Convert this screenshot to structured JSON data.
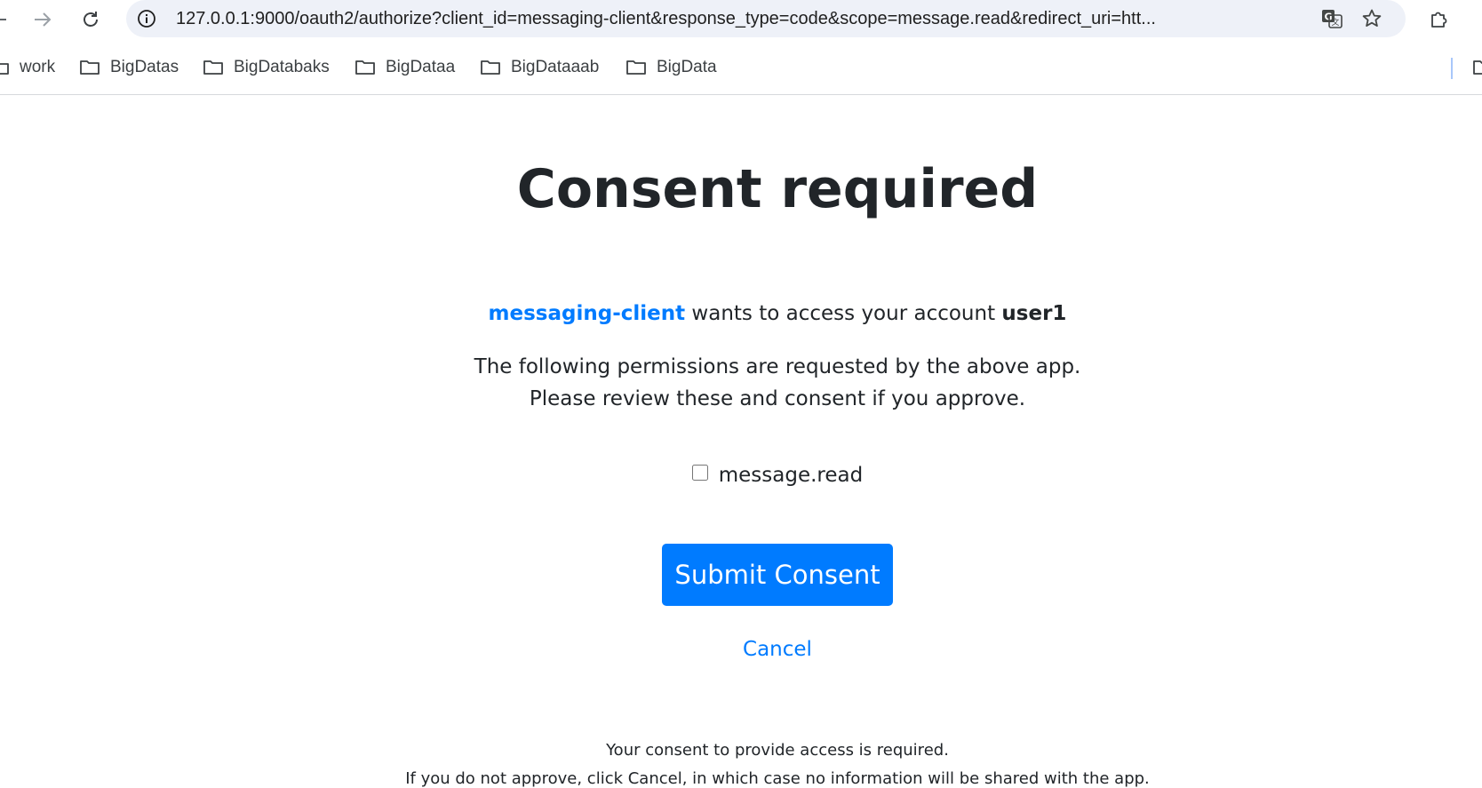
{
  "browser": {
    "url": "127.0.0.1:9000/oauth2/authorize?client_id=messaging-client&response_type=code&scope=message.read&redirect_uri=htt...",
    "bookmarks": [
      {
        "label": "work"
      },
      {
        "label": "BigDatas"
      },
      {
        "label": "BigDatabaks"
      },
      {
        "label": "BigDataa"
      },
      {
        "label": "BigDataaab"
      },
      {
        "label": "BigData"
      }
    ],
    "icons": {
      "back": "back-arrow-icon",
      "forward": "forward-arrow-icon",
      "reload": "reload-icon",
      "site_info": "info-icon",
      "translate": "translate-icon",
      "bookmark_star": "star-icon",
      "extensions": "puzzle-icon",
      "folder": "folder-icon"
    }
  },
  "consent": {
    "title": "Consent required",
    "client_id": "messaging-client",
    "access_text": " wants to access your account ",
    "principal": "user1",
    "permissions_line1": "The following permissions are requested by the above app.",
    "permissions_line2": "Please review these and consent if you approve.",
    "scopes": [
      {
        "name": "message.read",
        "checked": false
      }
    ],
    "submit_label": "Submit Consent",
    "cancel_label": "Cancel",
    "footer_line1": "Your consent to provide access is required.",
    "footer_line2": "If you do not approve, click Cancel, in which case no information will be shared with the app."
  },
  "colors": {
    "primary": "#007bff",
    "text": "#212529",
    "omnibox_bg": "#eef1f8"
  }
}
